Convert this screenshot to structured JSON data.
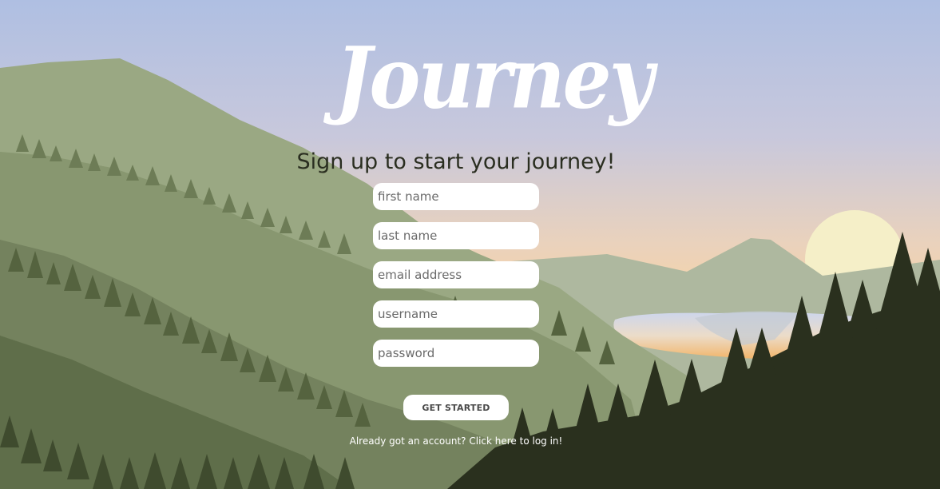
{
  "brand": {
    "logo_text": "Journey"
  },
  "signup": {
    "heading": "Sign up to start your journey!",
    "fields": {
      "first_name_placeholder": "first name",
      "last_name_placeholder": "last name",
      "email_placeholder": "email address",
      "username_placeholder": "username",
      "password_placeholder": "password"
    },
    "submit_label": "GET STARTED",
    "login_link_text": "Already got an account? Click here to log in!"
  },
  "colors": {
    "sky_top": "#b0bfe0",
    "sky_horizon": "#f6d2a2",
    "sun": "#f5efc8",
    "far_mountain": "#a9b394",
    "near_forest": "#2a301e",
    "heading_text": "#2a2e20",
    "input_bg": "#ffffff"
  }
}
